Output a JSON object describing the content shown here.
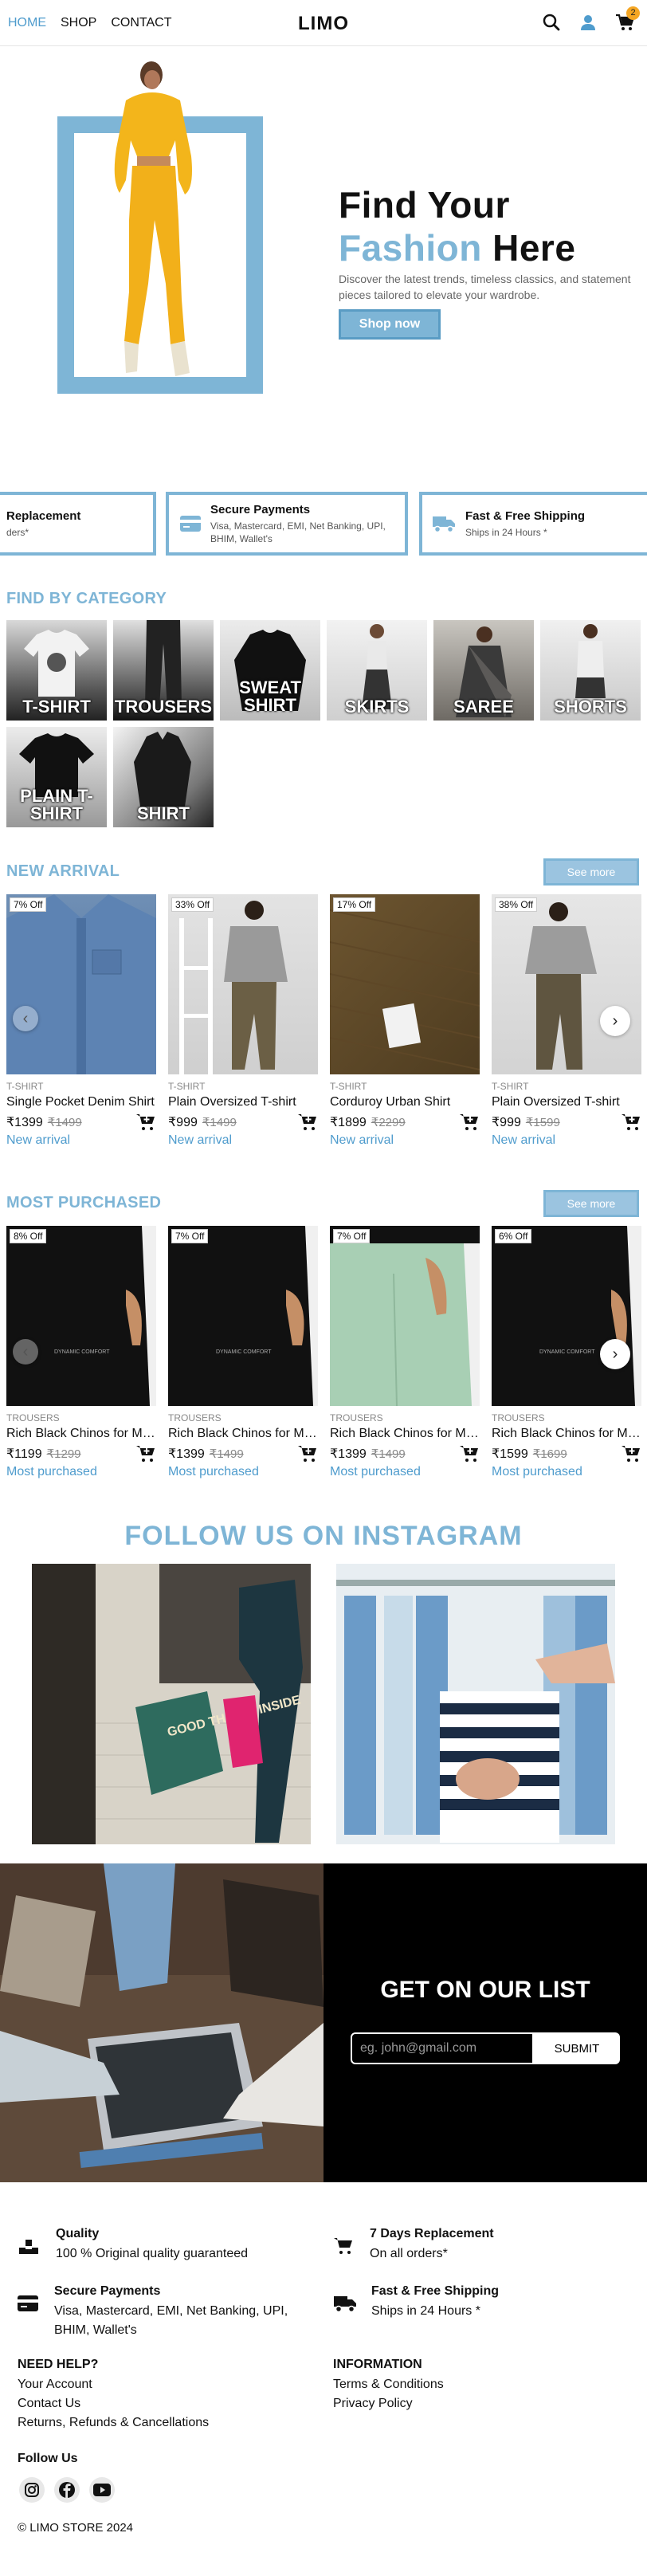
{
  "header": {
    "nav": [
      "HOME",
      "SHOP",
      "CONTACT"
    ],
    "logo": "LIMO",
    "cart_count": "2"
  },
  "hero": {
    "line1": "Find Your",
    "line2_blue": "Fashion",
    "line2_rest": "Here",
    "sub": "Discover the latest trends, timeless classics, and statement pieces tailored to elevate your wardrobe.",
    "button": "Shop now"
  },
  "features_strip": [
    {
      "title": "Replacement",
      "sub": "ders*"
    },
    {
      "title": "Secure Payments",
      "sub": "Visa, Mastercard, EMI, Net Banking, UPI, BHIM, Wallet's"
    },
    {
      "title": "Fast & Free Shipping",
      "sub": "Ships in 24 Hours *"
    }
  ],
  "categories": {
    "title": "FIND BY CATEGORY",
    "items": [
      "T-SHIRT",
      "TROUSERS",
      "SWEAT SHIRT",
      "SKIRTS",
      "SAREE",
      "SHORTS",
      "PLAIN T-SHIRT",
      "SHIRT"
    ]
  },
  "new_arrival": {
    "title": "NEW ARRIVAL",
    "see_more": "See more",
    "products": [
      {
        "off": "7% Off",
        "cat": "T-SHIRT",
        "name": "Single Pocket Denim Shirt",
        "price": "₹1399",
        "old": "₹1499",
        "tag": "New arrival"
      },
      {
        "off": "33% Off",
        "cat": "T-SHIRT",
        "name": "Plain Oversized T-shirt",
        "price": "₹999",
        "old": "₹1499",
        "tag": "New arrival"
      },
      {
        "off": "17% Off",
        "cat": "T-SHIRT",
        "name": "Corduroy Urban Shirt",
        "price": "₹1899",
        "old": "₹2299",
        "tag": "New arrival"
      },
      {
        "off": "38% Off",
        "cat": "T-SHIRT",
        "name": "Plain Oversized T-shirt",
        "price": "₹999",
        "old": "₹1599",
        "tag": "New arrival"
      }
    ]
  },
  "most_purchased": {
    "title": "MOST PURCHASED",
    "see_more": "See more",
    "products": [
      {
        "off": "8% Off",
        "cat": "TROUSERS",
        "name": "Rich Black Chinos for Men",
        "price": "₹1199",
        "old": "₹1299",
        "tag": "Most purchased"
      },
      {
        "off": "7% Off",
        "cat": "TROUSERS",
        "name": "Rich Black Chinos for Men",
        "price": "₹1399",
        "old": "₹1499",
        "tag": "Most purchased"
      },
      {
        "off": "7% Off",
        "cat": "TROUSERS",
        "name": "Rich Black Chinos for Men",
        "price": "₹1399",
        "old": "₹1499",
        "tag": "Most purchased"
      },
      {
        "off": "6% Off",
        "cat": "TROUSERS",
        "name": "Rich Black Chinos for Men",
        "price": "₹1599",
        "old": "₹1699",
        "tag": "Most purchased"
      }
    ]
  },
  "instagram": {
    "title": "FOLLOW US ON INSTAGRAM",
    "bag_text": "GOOD THINGS INSIDE"
  },
  "newsletter": {
    "title": "GET ON OUR LIST",
    "placeholder": "eg. john@gmail.com",
    "button": "SUBMIT"
  },
  "footer": {
    "features": [
      {
        "title": "Quality",
        "sub": "100 % Original quality guaranteed"
      },
      {
        "title": "7 Days Replacement",
        "sub": "On all orders*"
      },
      {
        "title": "Secure Payments",
        "sub": "Visa, Mastercard, EMI, Net Banking, UPI, BHIM, Wallet's"
      },
      {
        "title": "Fast & Free Shipping",
        "sub": "Ships in 24 Hours *"
      }
    ],
    "help_title": "NEED HELP?",
    "help_links": [
      "Your Account",
      "Contact Us",
      "Returns, Refunds & Cancellations"
    ],
    "info_title": "INFORMATION",
    "info_links": [
      "Terms & Conditions",
      "Privacy Policy"
    ],
    "follow_title": "Follow Us",
    "copyright": "© LIMO STORE 2024"
  },
  "colors": {
    "accent": "#7eb5d6",
    "link": "#4f9ccd",
    "badge": "#f5a623"
  }
}
